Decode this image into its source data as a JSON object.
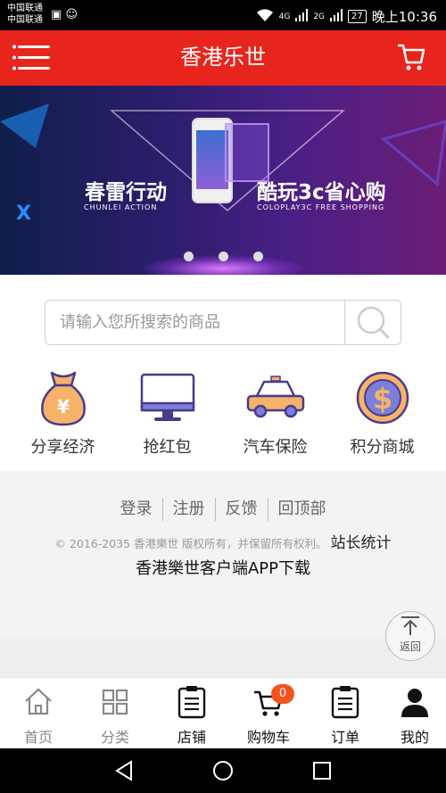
{
  "status_bar": {
    "carrier_1": "中国联通",
    "carrier_2": "中国联通",
    "net_1": "4G",
    "net_2": "2G",
    "battery": "27",
    "time": "晚上10:36"
  },
  "header": {
    "title": "香港乐世",
    "menu_icon": "menu-icon",
    "cart_icon": "cart-icon",
    "color": "#e8251d"
  },
  "banner": {
    "left_title": "春雷行动",
    "left_subtitle": "CHUNLEI ACTION",
    "right_title": "酷玩3c省心购",
    "right_subtitle": "COLOPLAY3C FREE SHOPPING",
    "page_count": 3
  },
  "search": {
    "placeholder": "请输入您所搜索的商品",
    "value": ""
  },
  "categories": [
    {
      "label": "分享经济",
      "icon": "money-bag-icon"
    },
    {
      "label": "抢红包",
      "icon": "monitor-icon"
    },
    {
      "label": "汽车保险",
      "icon": "car-icon"
    },
    {
      "label": "积分商城",
      "icon": "dollar-coin-icon"
    }
  ],
  "footer": {
    "links": [
      "登录",
      "注册",
      "反馈",
      "回顶部"
    ],
    "copyright": "© 2016-2035 香港樂世 版权所有，并保留所有权利。",
    "stats_link": "站长统计",
    "app_download": "香港樂世客户端APP下载",
    "back_to_top": "返回"
  },
  "tabbar": {
    "tabs": [
      {
        "label": "首页",
        "icon": "home-icon"
      },
      {
        "label": "分类",
        "icon": "grid-icon"
      },
      {
        "label": "店铺",
        "icon": "store-list-icon"
      },
      {
        "label": "购物车",
        "icon": "shopping-cart-icon",
        "badge": "0"
      },
      {
        "label": "订单",
        "icon": "order-list-icon"
      },
      {
        "label": "我的",
        "icon": "user-icon"
      }
    ]
  }
}
